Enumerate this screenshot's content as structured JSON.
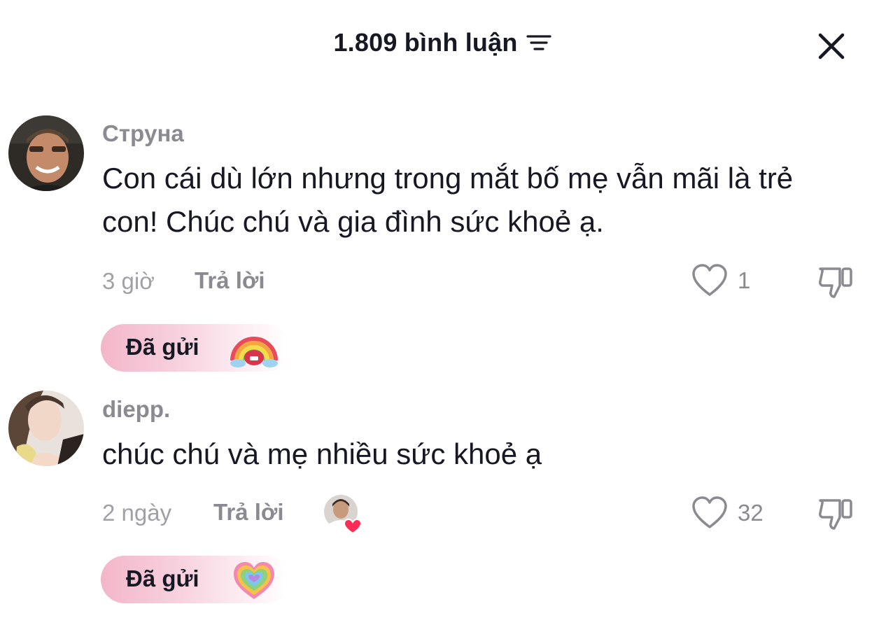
{
  "header": {
    "title": "1.809 bình luận",
    "sort_icon": "sort-lines-icon",
    "close_icon": "close-icon"
  },
  "comments": [
    {
      "username": "Стpyнa",
      "text": "Con cái dù lớn nhưng trong mắt bố mẹ vẫn mãi là trẻ con! Chúc chú và gia đình sức khoẻ ạ.",
      "time": "3 giờ",
      "reply_label": "Trả lời",
      "likes": "1",
      "sent_label": "Đã gửi",
      "sent_emoji": "rainbow-face-sticker"
    },
    {
      "username": "diepp.",
      "text": "chúc chú và mẹ nhiều sức khoẻ ạ",
      "time": "2 ngày",
      "reply_label": "Trả lời",
      "likes": "32",
      "creator_liked": true,
      "sent_label": "Đã gửi",
      "sent_emoji": "rainbow-heart-sticker"
    }
  ],
  "colors": {
    "text_primary": "#161823",
    "text_secondary": "#8a8b91",
    "chip_pink": "#f3b6c9",
    "heart_red": "#fe2c55"
  }
}
